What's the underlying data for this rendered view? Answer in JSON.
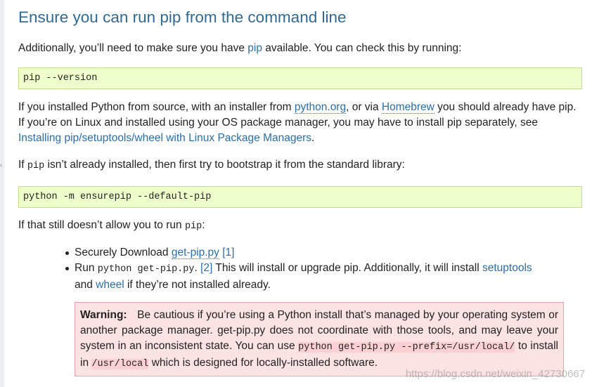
{
  "heading": "Ensure you can run pip from the command line",
  "intro": {
    "before": "Additionally, you’ll need to make sure you have ",
    "link": "pip",
    "after": " available. You can check this by running:"
  },
  "code1": "pip --version",
  "source_para": {
    "t1": "If you installed Python from source, with an installer from ",
    "link1": "python.org",
    "t2": ", or via ",
    "link2": "Homebrew",
    "t3": " you should already have pip. If you’re on Linux and installed using your OS package manager, you may have to install pip separately, see ",
    "link3": "Installing pip/setuptools/wheel with Linux Package Managers",
    "t4": "."
  },
  "bootstrap_para": {
    "t1": "If ",
    "code": "pip",
    "t2": " isn’t already installed, then first try to bootstrap it from the standard library:"
  },
  "code2": "python -m ensurepip --default-pip",
  "still_para": {
    "t1": "If that still doesn’t allow you to run ",
    "code": "pip",
    "t2": ":"
  },
  "list": {
    "item1": {
      "t1": "Securely Download ",
      "link": "get-pip.py",
      "ref": "[1]"
    },
    "item2": {
      "t1": "Run ",
      "code": "python get-pip.py",
      "t2": ". ",
      "ref": "[2]",
      "t3": " This will install or upgrade pip. Additionally, it will install ",
      "link1": "setuptools",
      "t4": " and ",
      "link2": "wheel",
      "t5": " if they’re not installed already."
    }
  },
  "warning": {
    "title": "Warning:",
    "t1": "Be cautious if you’re using a Python install that’s managed by your operating system or another package manager. get-pip.py does not coordinate with those tools, and may leave your system in an inconsistent state. You can use ",
    "code1": "python get-pip.py --prefix=/usr/local/",
    "t2": " to install in ",
    "code2": "/usr/local",
    "t3": " which is designed for locally-installed software."
  },
  "watermark": "https://blog.csdn.net/weixin_42730667",
  "stray_mark": "‹"
}
